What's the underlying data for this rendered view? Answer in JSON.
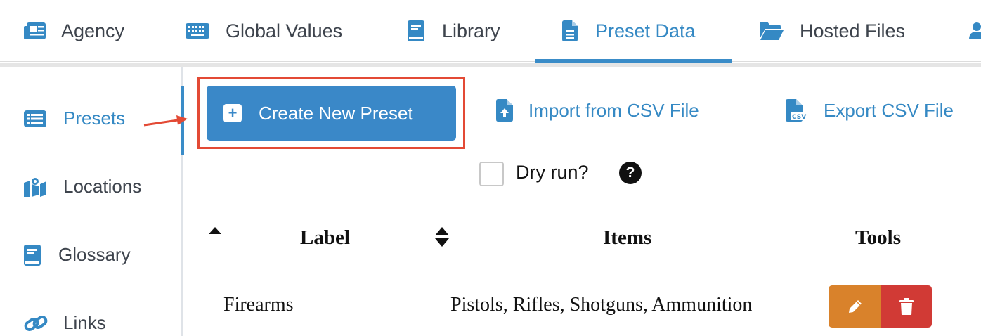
{
  "topnav": {
    "tabs": [
      {
        "label": "Agency",
        "icon": "newspaper-icon"
      },
      {
        "label": "Global Values",
        "icon": "keyboard-icon"
      },
      {
        "label": "Library",
        "icon": "book-icon"
      },
      {
        "label": "Preset Data",
        "icon": "file-icon",
        "active": true
      },
      {
        "label": "Hosted Files",
        "icon": "folder-open-icon"
      }
    ]
  },
  "sidebar": {
    "items": [
      {
        "label": "Presets",
        "icon": "list-icon",
        "active": true
      },
      {
        "label": "Locations",
        "icon": "map-icon"
      },
      {
        "label": "Glossary",
        "icon": "book-icon"
      },
      {
        "label": "Links",
        "icon": "link-icon"
      }
    ]
  },
  "toolbar": {
    "create_label": "Create New Preset",
    "import_label": "Import from CSV File",
    "export_label": "Export CSV File",
    "dry_run_label": "Dry run?",
    "help_symbol": "?"
  },
  "table": {
    "headers": [
      "Label",
      "Items",
      "Tools"
    ],
    "rows": [
      {
        "label": "Firearms",
        "items": "Pistols, Rifles, Shotguns, Ammunition"
      }
    ]
  },
  "colors": {
    "accent": "#3a88c8",
    "highlight": "#e34a35",
    "edit": "#d9822b",
    "delete": "#d13a35"
  }
}
